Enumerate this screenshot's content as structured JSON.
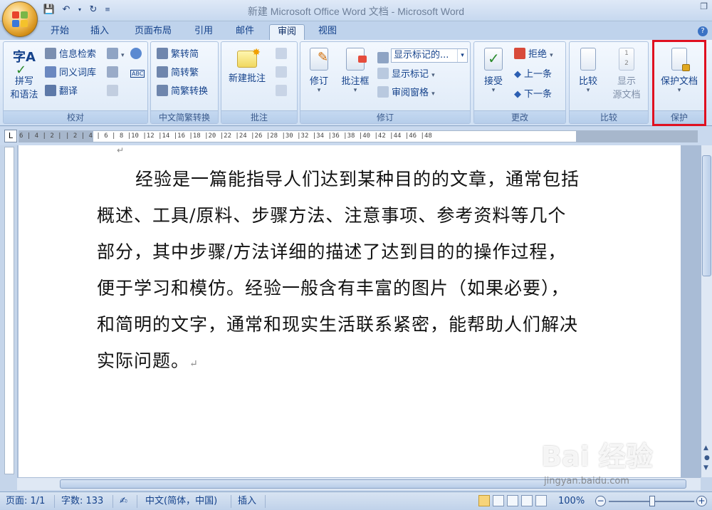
{
  "window": {
    "title": "新建 Microsoft Office Word 文档 - Microsoft Word"
  },
  "tabs": [
    {
      "label": "开始"
    },
    {
      "label": "插入"
    },
    {
      "label": "页面布局"
    },
    {
      "label": "引用"
    },
    {
      "label": "邮件"
    },
    {
      "label": "审阅",
      "active": true
    },
    {
      "label": "视图"
    }
  ],
  "ribbon": {
    "proofing": {
      "group_label": "校对",
      "spelling_line1": "拼写",
      "spelling_line2": "和语法",
      "research": "信息检索",
      "thesaurus": "同义词库",
      "translate": "翻译"
    },
    "chinese": {
      "group_label": "中文简繁转换",
      "to_traditional": "繁转简",
      "to_simplified": "简转繁",
      "convert": "简繁转换"
    },
    "comments": {
      "group_label": "批注",
      "new_comment": "新建批注"
    },
    "tracking": {
      "group_label": "修订",
      "track_changes": "修订",
      "balloons": "批注框",
      "markup_dropdown": "显示标记的...",
      "show_markup": "显示标记",
      "reviewing_pane": "审阅窗格"
    },
    "changes": {
      "group_label": "更改",
      "accept": "接受",
      "reject": "拒绝",
      "previous": "上一条",
      "next": "下一条"
    },
    "compare": {
      "group_label": "比较",
      "compare": "比较",
      "show_source_line1": "显示",
      "show_source_line2": "源文档"
    },
    "protect": {
      "group_label": "保护",
      "protect_document": "保护文档"
    }
  },
  "ruler": {
    "text": "6 | 4 | 2 |   | 2 | 4 | 6 | 8 |10 |12 |14 |16 |18 |20 |22 |24 |26 |28 |30 |32 |34 |36 |38 |40 |42 |44 |46 |48"
  },
  "document": {
    "paragraph": "经验是一篇能指导人们达到某种目的的文章，通常包括概述、工具/原料、步骤方法、注意事项、参考资料等几个部分，其中步骤/方法详细的描述了达到目的的操作过程，便于学习和模仿。经验一般含有丰富的图片（如果必要），和简明的文字，通常和现实生活联系紧密，能帮助人们解决实际问题。"
  },
  "statusbar": {
    "page": "页面: 1/1",
    "word_count": "字数: 133",
    "language": "中文(简体，中国)",
    "insert_mode": "插入",
    "zoom": "100%"
  },
  "watermark": {
    "brand": "Bai 经验",
    "url": "jingyan.baidu.com"
  },
  "colors": {
    "accent_red": "#e01020",
    "ribbon_text": "#15428b"
  }
}
